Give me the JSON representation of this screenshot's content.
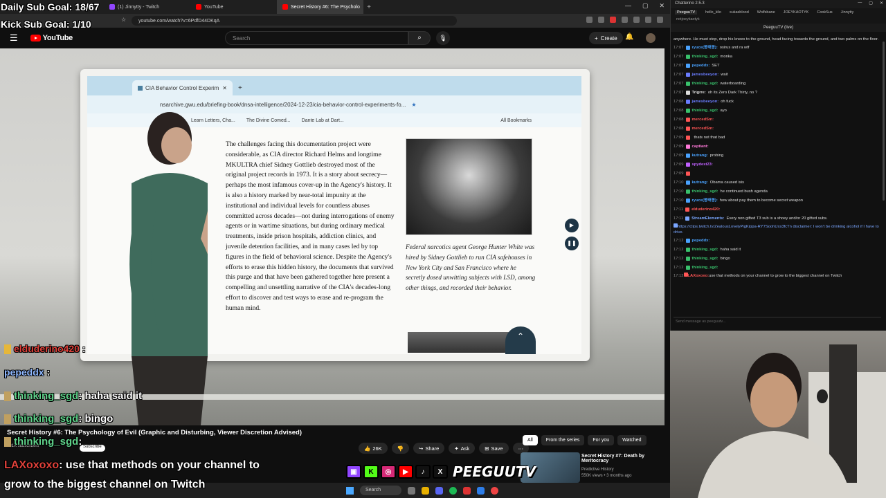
{
  "overlay": {
    "daily_goal": "Daily Sub Goal: 18/67",
    "kick_goal": "Kick Sub Goal: 1/10"
  },
  "browser": {
    "tabs": [
      {
        "label": "(1) Jinnytty - Twitch"
      },
      {
        "label": "YouTube"
      },
      {
        "label": "Secret History #6: The Psycholo"
      }
    ],
    "url": "youtube.com/watch?v=6PdfD44DKqA"
  },
  "youtube": {
    "logo": "YouTube",
    "search_placeholder": "Search",
    "create_label": "Create",
    "video_title": "Secret History #6: The Psychology of Evil (Graphic and Disturbing, Viewer Discretion Advised)",
    "subscribers": "931K subscribers",
    "subscribe_label": "Subscribe",
    "likes": "26K",
    "share_label": "Share",
    "ask_label": "Ask",
    "save_label": "Save",
    "chips": [
      "All",
      "From the series",
      "For you",
      "Watched"
    ],
    "recommendation": {
      "title": "Secret History #7: Death by Meritocracy",
      "channel": "Predictive History",
      "meta": "550K views • 3 months ago"
    }
  },
  "inner_browser": {
    "tab_label": "CIA Behavior Control Experim",
    "url": "nsarchive.gwu.edu/briefing-book/dnsa-intelligence/2024-12-23/cia-behavior-control-experiments-fo...",
    "bookmarks": [
      "Learn Letters, Cha...",
      "The Divine Comed...",
      "Dante Lab at Dart..."
    ],
    "all_bookmarks": "All Bookmarks",
    "paragraph": "The challenges facing this documentation project were considerable, as CIA director Richard Helms and longtime MKULTRA chief Sidney Gottlieb destroyed most of the original project records in 1973. It is a story about secrecy—perhaps the most infamous cover-up in the Agency's history. It is also a history marked by near-total impunity at the institutional and individual levels for countless abuses committed across decades—not during interrogations of enemy agents or in wartime situations, but during ordinary medical treatments, inside prison hospitals, addiction clinics, and juvenile detention facilities, and in many cases led by top figures in the field of behavioral science. Despite the Agency's efforts to erase this hidden history, the documents that survived this purge and that have been gathered together here present a compelling and unsettling narrative of the CIA's decades-long effort to discover and test ways to erase and re-program the human mind.",
    "caption": "Federal narcotics agent George Hunter White was hired by Sidney Gottlieb to run CIA safehouses in New York City and San Francisco where he secretly dosed unwitting subjects with LSD, among other things, and recorded their behavior."
  },
  "video_chat_overlay": [
    {
      "user": "elduderino420",
      "msg": ":",
      "color": "red"
    },
    {
      "user": "pepeddx",
      "msg": ":",
      "color": "blue"
    },
    {
      "user": "thinking_sgd",
      "msg": ": haha said it",
      "color": "green"
    },
    {
      "user": "thinking_sgd",
      "msg": ": bingo",
      "color": "green"
    },
    {
      "user": "thinking_sgd",
      "msg": ":",
      "color": "green"
    },
    {
      "user": "LAXoxoxo",
      "msg": ": use that methods on your channel to",
      "color": "red"
    },
    {
      "user": "",
      "msg": "grow to the biggest channel on Twitch",
      "color": "white"
    }
  ],
  "brand": "PEEGUUTV",
  "taskbar": {
    "search": "Search"
  },
  "chat": {
    "app_title": "Chatterino 2.5.3",
    "channel_label": "PeeguuTV (live)",
    "tabs": [
      "PeeguuTV",
      "hello_kilo",
      "sukasblood",
      "Wolfsbane",
      "JOEYKAOTYK",
      "CookSus",
      "Jinnytty"
    ],
    "subtab": "notjoeykaotyk",
    "top_note": "anywhere. He must stop, drop his knees to the ground, head facing towards the ground, and two palms on the floor.",
    "messages": [
      {
        "ts": "17:07",
        "user": "ryuce(봉태봉):",
        "msg": "osirus and ra wtf",
        "color": "#4aa3ff"
      },
      {
        "ts": "17:07",
        "user": "thinking_sgd:",
        "msg": "monka",
        "color": "#39c16c"
      },
      {
        "ts": "17:07",
        "user": "pepeddx:",
        "msg": "SET",
        "color": "#4aa3ff"
      },
      {
        "ts": "17:07",
        "user": "jamesbeeyon:",
        "msg": "wait",
        "color": "#6a7dff"
      },
      {
        "ts": "17:07",
        "user": "thinking_sgd:",
        "msg": "waterboarding",
        "color": "#39c16c"
      },
      {
        "ts": "17:07",
        "user": "Trigrre:",
        "msg": "oh its Zero Dark Thirty, no ?",
        "color": "#dddddd"
      },
      {
        "ts": "17:08",
        "user": "jamesbeeyon:",
        "msg": "oh fuck",
        "color": "#6a7dff"
      },
      {
        "ts": "17:08",
        "user": "thinking_sgd:",
        "msg": "ayo",
        "color": "#39c16c"
      },
      {
        "ts": "17:08",
        "user": "mercedSm:",
        "msg": "",
        "color": "#ff5555"
      },
      {
        "ts": "17:08",
        "user": "mercedSm:",
        "msg": "",
        "color": "#ff5555"
      },
      {
        "ts": "17:09",
        "user": "",
        "msg": "thats not that bad",
        "color": "#ff5555"
      },
      {
        "ts": "17:09",
        "user": "captiant:",
        "msg": "",
        "color": "#ff7ad9"
      },
      {
        "ts": "17:09",
        "user": "kutrang:",
        "msg": "probing",
        "color": "#4aa3ff"
      },
      {
        "ts": "17:09",
        "user": "spydest23:",
        "msg": "",
        "color": "#c060ff"
      },
      {
        "ts": "17:09",
        "user": "",
        "msg": "",
        "color": "#ff5555"
      },
      {
        "ts": "17:10",
        "user": "kutrang:",
        "msg": "Obama caused isis",
        "color": "#4aa3ff"
      },
      {
        "ts": "17:10",
        "user": "thinking_sgd:",
        "msg": "he continued bush agenda",
        "color": "#39c16c"
      },
      {
        "ts": "17:10",
        "user": "ryuce(봉태봉):",
        "msg": "how about pay them to become secret weapon",
        "color": "#4aa3ff"
      },
      {
        "ts": "17:11",
        "user": "elduderino420:",
        "msg": "",
        "color": "#ff5555"
      },
      {
        "ts": "17:11",
        "user": "StreamElements:",
        "msg": "Every non gifted T3 sub is a shoey and/or 20 gifted subs.",
        "color": "#7aa6ff"
      },
      {
        "ts": "",
        "user": "",
        "msg": "https://clips.twitch.tv/ZealousLovelyPigKippa-RY7SoohUxs3fcTn disclaimer: I won't be drinking alcohol if I have to drive.",
        "color": "#7aa6ff"
      },
      {
        "ts": "17:12",
        "user": "pepeddx:",
        "msg": "",
        "color": "#4aa3ff"
      },
      {
        "ts": "17:12",
        "user": "thinking_sgd:",
        "msg": "haha said it",
        "color": "#39c16c"
      },
      {
        "ts": "17:12",
        "user": "thinking_sgd:",
        "msg": "bingo",
        "color": "#39c16c"
      },
      {
        "ts": "17:12",
        "user": "thinking_sgd:",
        "msg": "",
        "color": "#39c16c"
      },
      {
        "ts": "17:12",
        "user": "LAXoxoxo:",
        "msg": "use that methods on your channel to grow to the biggest channel on Twitch",
        "color": "#ff5555"
      }
    ],
    "input_placeholder": "Send message as peeguutv..."
  }
}
